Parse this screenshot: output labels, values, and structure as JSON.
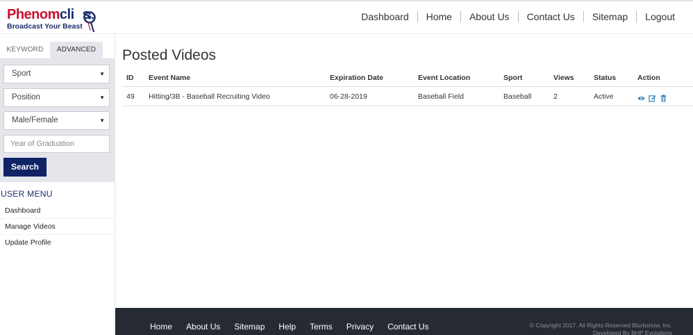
{
  "brand": {
    "name_part1": "Phenom",
    "name_part2": "cli",
    "name_part3": "s",
    "tagline": "Broadcast Your Beast"
  },
  "nav": {
    "items": [
      "Dashboard",
      "Home",
      "About Us",
      "Contact Us",
      "Sitemap",
      "Logout"
    ]
  },
  "sidebar": {
    "tabs": [
      "KEYWORD",
      "ADVANCED"
    ],
    "active_tab": "ADVANCED",
    "filters": {
      "sport": "Sport",
      "position": "Position",
      "gender": "Male/Female",
      "graduation_placeholder": "Year of Graduation"
    },
    "search_label": "Search",
    "user_menu_title": "USER MENU",
    "menu": [
      "Dashboard",
      "Manage Videos",
      "Update Profile"
    ]
  },
  "main": {
    "title": "Posted Videos",
    "columns": [
      "ID",
      "Event Name",
      "Expiration Date",
      "Event Location",
      "Sport",
      "Views",
      "Status",
      "Action"
    ],
    "rows": [
      {
        "id": "49",
        "event_name": "Hitting/3B - Baseball Recruiting Video",
        "expiration_date": "06-28-2019",
        "event_location": "Baseball Field",
        "sport": "Baseball",
        "views": "2",
        "status": "Active",
        "actions": [
          "view-icon",
          "edit-icon",
          "delete-icon"
        ]
      }
    ]
  },
  "footer": {
    "links": [
      "Home",
      "About Us",
      "Sitemap",
      "Help",
      "Terms",
      "Privacy",
      "Contact Us"
    ],
    "copyright": "© Copyright 2017. All Rights Reserved Blurbshow, Inc.",
    "developed": "Developed By BHP Evolutions"
  },
  "colors": {
    "brand_red": "#c8102e",
    "brand_navy": "#1d2d6b",
    "button": "#0e2266",
    "footer_bg": "#262b33",
    "action_icon": "#2b7bb9"
  }
}
